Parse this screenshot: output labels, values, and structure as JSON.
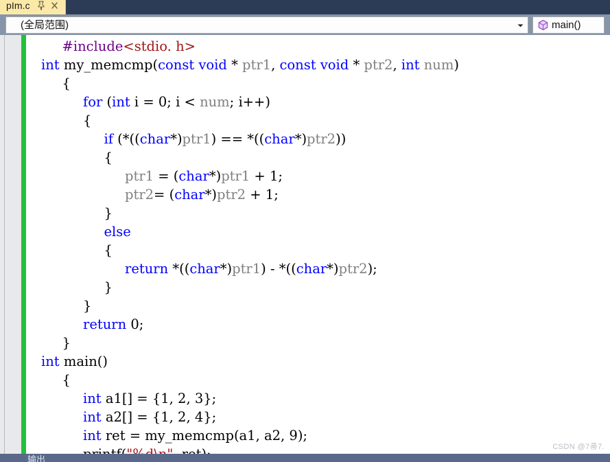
{
  "window": {
    "tab": {
      "title": "pIm.c",
      "pin_icon": "pin-icon",
      "close_icon": "close-icon"
    }
  },
  "navbar": {
    "scope": {
      "value": "(全局范围)",
      "arrow_icon": "chevron-down-icon"
    },
    "member": {
      "value": "main()",
      "icon": "method-cube-icon"
    }
  },
  "editor": {
    "change_bar_color": "#22c03c",
    "lines": [
      {
        "indent": 1,
        "outline": "none",
        "tokens": [
          {
            "t": "#include",
            "c": "pre"
          },
          {
            "t": "<stdio. h>",
            "c": "str"
          }
        ]
      },
      {
        "indent": 0,
        "outline": "collapse",
        "tokens": [
          {
            "t": "int",
            "c": "kw"
          },
          {
            "t": " my_memcmp(",
            "c": "plain"
          },
          {
            "t": "const",
            "c": "kw"
          },
          {
            "t": " ",
            "c": "plain"
          },
          {
            "t": "void",
            "c": "kw"
          },
          {
            "t": " * ",
            "c": "plain"
          },
          {
            "t": "ptr1",
            "c": "param"
          },
          {
            "t": ", ",
            "c": "plain"
          },
          {
            "t": "const",
            "c": "kw"
          },
          {
            "t": " ",
            "c": "plain"
          },
          {
            "t": "void",
            "c": "kw"
          },
          {
            "t": " * ",
            "c": "plain"
          },
          {
            "t": "ptr2",
            "c": "param"
          },
          {
            "t": ", ",
            "c": "plain"
          },
          {
            "t": "int",
            "c": "kw"
          },
          {
            "t": " ",
            "c": "plain"
          },
          {
            "t": "num",
            "c": "param"
          },
          {
            "t": ")",
            "c": "plain"
          }
        ]
      },
      {
        "indent": 1,
        "outline": "none",
        "tokens": [
          {
            "t": "{",
            "c": "plain"
          }
        ]
      },
      {
        "indent": 2,
        "outline": "none",
        "tokens": [
          {
            "t": "for",
            "c": "kw"
          },
          {
            "t": " (",
            "c": "plain"
          },
          {
            "t": "int",
            "c": "kw"
          },
          {
            "t": " i = 0; i < ",
            "c": "plain"
          },
          {
            "t": "num",
            "c": "param"
          },
          {
            "t": "; i++)",
            "c": "plain"
          }
        ]
      },
      {
        "indent": 2,
        "outline": "none",
        "tokens": [
          {
            "t": "{",
            "c": "plain"
          }
        ]
      },
      {
        "indent": 3,
        "outline": "none",
        "tokens": [
          {
            "t": "if",
            "c": "kw"
          },
          {
            "t": " (*((",
            "c": "plain"
          },
          {
            "t": "char",
            "c": "kw"
          },
          {
            "t": "*)",
            "c": "plain"
          },
          {
            "t": "ptr1",
            "c": "param"
          },
          {
            "t": ") == *((",
            "c": "plain"
          },
          {
            "t": "char",
            "c": "kw"
          },
          {
            "t": "*)",
            "c": "plain"
          },
          {
            "t": "ptr2",
            "c": "param"
          },
          {
            "t": "))",
            "c": "plain"
          }
        ]
      },
      {
        "indent": 3,
        "outline": "none",
        "tokens": [
          {
            "t": "{",
            "c": "plain"
          }
        ]
      },
      {
        "indent": 4,
        "outline": "none",
        "tokens": [
          {
            "t": "ptr1",
            "c": "param"
          },
          {
            "t": " = (",
            "c": "plain"
          },
          {
            "t": "char",
            "c": "kw"
          },
          {
            "t": "*)",
            "c": "plain"
          },
          {
            "t": "ptr1",
            "c": "param"
          },
          {
            "t": " + 1;",
            "c": "plain"
          }
        ]
      },
      {
        "indent": 4,
        "outline": "none",
        "tokens": [
          {
            "t": "ptr2",
            "c": "param"
          },
          {
            "t": "= (",
            "c": "plain"
          },
          {
            "t": "char",
            "c": "kw"
          },
          {
            "t": "*)",
            "c": "plain"
          },
          {
            "t": "ptr2",
            "c": "param"
          },
          {
            "t": " + 1;",
            "c": "plain"
          }
        ]
      },
      {
        "indent": 3,
        "outline": "none",
        "tokens": [
          {
            "t": "}",
            "c": "plain"
          }
        ]
      },
      {
        "indent": 3,
        "outline": "none",
        "tokens": [
          {
            "t": "else",
            "c": "kw"
          }
        ]
      },
      {
        "indent": 3,
        "outline": "none",
        "tokens": [
          {
            "t": "{",
            "c": "plain"
          }
        ]
      },
      {
        "indent": 4,
        "outline": "none",
        "tokens": [
          {
            "t": "return",
            "c": "kw"
          },
          {
            "t": " *((",
            "c": "plain"
          },
          {
            "t": "char",
            "c": "kw"
          },
          {
            "t": "*)",
            "c": "plain"
          },
          {
            "t": "ptr1",
            "c": "param"
          },
          {
            "t": ") - *((",
            "c": "plain"
          },
          {
            "t": "char",
            "c": "kw"
          },
          {
            "t": "*)",
            "c": "plain"
          },
          {
            "t": "ptr2",
            "c": "param"
          },
          {
            "t": ");",
            "c": "plain"
          }
        ]
      },
      {
        "indent": 3,
        "outline": "none",
        "tokens": [
          {
            "t": "}",
            "c": "plain"
          }
        ]
      },
      {
        "indent": 2,
        "outline": "none",
        "tokens": [
          {
            "t": "}",
            "c": "plain"
          }
        ]
      },
      {
        "indent": 2,
        "outline": "none",
        "tokens": [
          {
            "t": "return",
            "c": "kw"
          },
          {
            "t": " 0;",
            "c": "plain"
          }
        ]
      },
      {
        "indent": 1,
        "outline": "none",
        "tokens": [
          {
            "t": "}",
            "c": "plain"
          }
        ]
      },
      {
        "indent": 0,
        "outline": "collapse",
        "tokens": [
          {
            "t": "int",
            "c": "kw"
          },
          {
            "t": " main()",
            "c": "plain"
          }
        ]
      },
      {
        "indent": 1,
        "outline": "none",
        "tokens": [
          {
            "t": "{",
            "c": "plain"
          }
        ]
      },
      {
        "indent": 2,
        "outline": "none",
        "tokens": [
          {
            "t": "int",
            "c": "kw"
          },
          {
            "t": " a1[] = {1, 2, 3};",
            "c": "plain"
          }
        ]
      },
      {
        "indent": 2,
        "outline": "none",
        "tokens": [
          {
            "t": "int",
            "c": "kw"
          },
          {
            "t": " a2[] = {1, 2, 4};",
            "c": "plain"
          }
        ]
      },
      {
        "indent": 2,
        "outline": "none",
        "tokens": [
          {
            "t": "int",
            "c": "kw"
          },
          {
            "t": " ret = my_memcmp(a1, a2, 9);",
            "c": "plain"
          }
        ]
      },
      {
        "indent": 2,
        "outline": "none",
        "tokens": [
          {
            "t": "printf(",
            "c": "plain"
          },
          {
            "t": "\"%d\\n\"",
            "c": "str"
          },
          {
            "t": ", ret);",
            "c": "plain"
          }
        ]
      }
    ]
  },
  "bottom_panel": {
    "label": "输出"
  },
  "watermark": {
    "text": "CSDN @7帚7."
  }
}
